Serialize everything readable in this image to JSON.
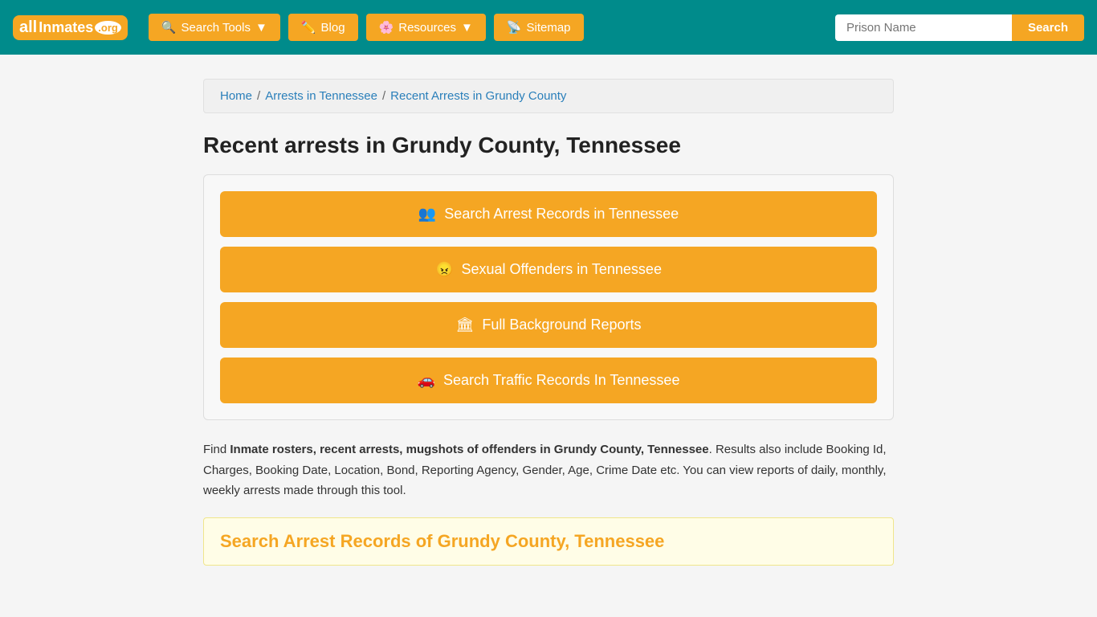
{
  "site": {
    "logo_all": "all",
    "logo_inmates": "Inmates",
    "logo_org": ".org"
  },
  "navbar": {
    "search_tools_label": "Search Tools",
    "blog_label": "Blog",
    "resources_label": "Resources",
    "sitemap_label": "Sitemap",
    "search_placeholder": "Prison Name",
    "search_button_label": "Search"
  },
  "breadcrumb": {
    "home": "Home",
    "arrests_tn": "Arrests in Tennessee",
    "current": "Recent Arrests in Grundy County"
  },
  "page": {
    "title": "Recent arrests in Grundy County, Tennessee"
  },
  "action_buttons": [
    {
      "label": "Search Arrest Records in Tennessee",
      "icon": "👥"
    },
    {
      "label": "Sexual Offenders in Tennessee",
      "icon": "😠"
    },
    {
      "label": "Full Background Reports",
      "icon": "🏛"
    },
    {
      "label": "Search Traffic Records In Tennessee",
      "icon": "🚗"
    }
  ],
  "description": {
    "intro": "Find ",
    "bold_part": "Inmate rosters, recent arrests, mugshots of offenders in Grundy County, Tennessee",
    "rest": ". Results also include Booking Id, Charges, Booking Date, Location, Bond, Reporting Agency, Gender, Age, Crime Date etc. You can view reports of daily, monthly, weekly arrests made through this tool."
  },
  "section": {
    "title": "Search Arrest Records of Grundy County, Tennessee"
  }
}
